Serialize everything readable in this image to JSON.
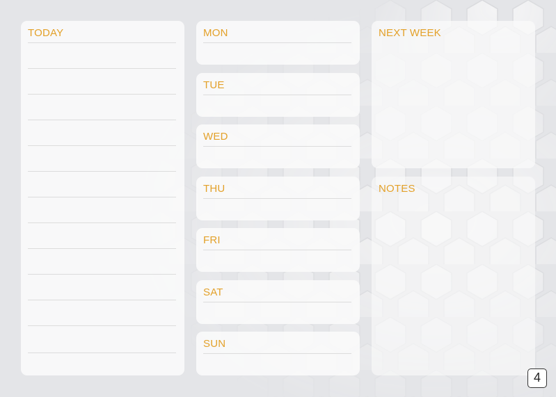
{
  "planner": {
    "today": {
      "label": "TODAY"
    },
    "days": [
      {
        "id": "mon",
        "label": "MON"
      },
      {
        "id": "tue",
        "label": "TUE"
      },
      {
        "id": "wed",
        "label": "WED"
      },
      {
        "id": "thu",
        "label": "THU"
      },
      {
        "id": "fri",
        "label": "FRI"
      },
      {
        "id": "sat",
        "label": "SAT"
      },
      {
        "id": "sun",
        "label": "SUN"
      }
    ],
    "next_week": {
      "label": "NEXT WEEK"
    },
    "notes": {
      "label": "NOTES"
    }
  },
  "page_number": "4",
  "colors": {
    "accent": "#e3a12a",
    "background": "#e4e5e8",
    "panel": "#fafafa",
    "rule": "#dcdcdc"
  }
}
